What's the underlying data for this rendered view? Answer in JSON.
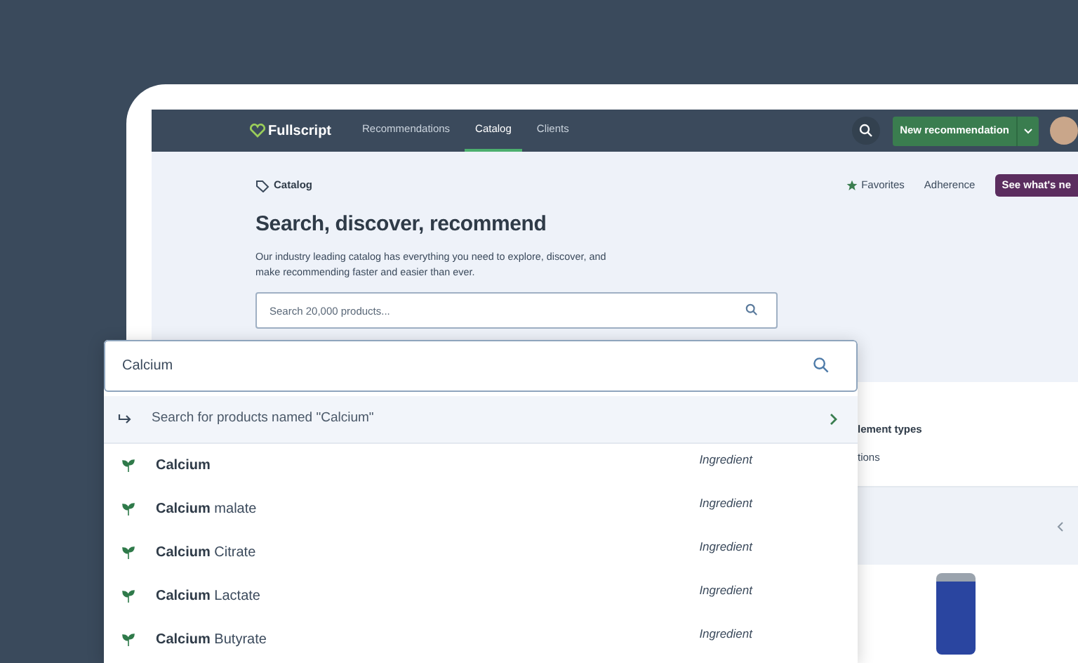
{
  "nav": {
    "brand": "Fullscript",
    "items": [
      {
        "label": "Recommendations",
        "selected": false
      },
      {
        "label": "Catalog",
        "selected": true
      },
      {
        "label": "Clients",
        "selected": false
      }
    ],
    "primary_button": "New recommendation"
  },
  "header": {
    "breadcrumb": "Catalog",
    "links": [
      "Favorites",
      "Adherence"
    ],
    "promo_button": "See what's ne",
    "title": "Search, discover, recommend",
    "description": "Our industry leading catalog has everything you need to explore, discover, and make recommending faster and easier than ever.",
    "search": {
      "placeholder": "Search 20,000 products..."
    }
  },
  "background_texts": [
    "lement types",
    "tions"
  ],
  "dropdown": {
    "query": "Calcium",
    "search_all": "Search for products named \"Calcium\"",
    "results": [
      {
        "match": "Calcium",
        "type": "Ingredient"
      },
      {
        "match": "Calcium",
        "rest": "malate",
        "type": "Ingredient"
      },
      {
        "match": "Calcium",
        "rest": "Citrate",
        "type": "Ingredient"
      },
      {
        "match": "Calcium",
        "rest": "Lactate",
        "type": "Ingredient"
      },
      {
        "match": "Calcium",
        "rest": "Butyrate",
        "type": "Ingredient"
      }
    ]
  }
}
